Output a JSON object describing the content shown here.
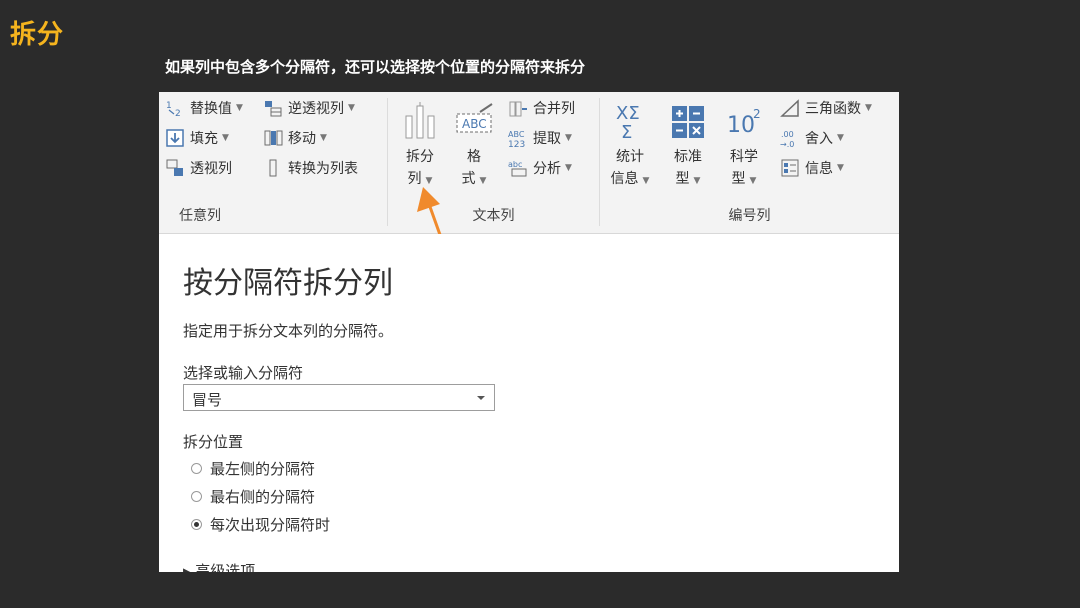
{
  "slide": {
    "title": "拆分",
    "subtitle": "如果列中包含多个分隔符，还可以选择按个位置的分隔符来拆分"
  },
  "ribbon": {
    "any_column": {
      "label": "任意列",
      "replace_values": "替换值",
      "unpivot": "逆透视列",
      "fill": "填充",
      "move": "移动",
      "pivot": "透视列",
      "convert_to_list": "转换为列表"
    },
    "text_column": {
      "label": "文本列",
      "split_column_line1": "拆分",
      "split_column_line2": "列",
      "format_line1": "格",
      "format_line2": "式",
      "merge_columns": "合并列",
      "extract": "提取",
      "parse": "分析",
      "abc_icon_text": "ABC",
      "abc123_top": "ABC",
      "abc123_bottom": "123",
      "parse_icon_text": "abc"
    },
    "number_column": {
      "label": "编号列",
      "statistics_line1": "统计",
      "statistics_line2": "信息",
      "standard_line1": "标准",
      "standard_line2": "型",
      "scientific_line1": "科学",
      "scientific_line2": "型",
      "trigonometry": "三角函数",
      "rounding": "舍入",
      "information": "信息",
      "sci_icon": "10",
      "sci_exp": "2",
      "round_icon_top": ".00",
      "round_icon_bottom": "→.0",
      "stats_icon_top": "XΣ",
      "stats_icon_bottom": "Σ"
    }
  },
  "dialog": {
    "title": "按分隔符拆分列",
    "description": "指定用于拆分文本列的分隔符。",
    "delimiter_label": "选择或输入分隔符",
    "delimiter_value": "冒号",
    "split_at_label": "拆分位置",
    "options": [
      {
        "label": "最左侧的分隔符",
        "checked": false
      },
      {
        "label": "最右侧的分隔符",
        "checked": false
      },
      {
        "label": "每次出现分隔符时",
        "checked": true
      }
    ],
    "advanced": "▸ 高级选项"
  },
  "colors": {
    "accent_title": "#f5b41e",
    "arrow": "#f08a2c",
    "icon_blue": "#4a78b0",
    "icon_gray": "#6d6d6d"
  }
}
